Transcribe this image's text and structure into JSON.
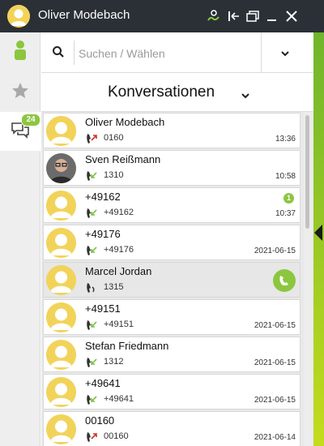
{
  "window": {
    "title": "Oliver Modebach"
  },
  "icons": {
    "title_avatar": "user-avatar-icon",
    "call_forward": "call-forward-icon",
    "pin": "pin-icon",
    "window_restore": "window-restore-icon",
    "minimize": "minimize-icon",
    "close": "close-icon",
    "contacts": "contacts-icon",
    "favorites": "star-icon",
    "conversations": "chat-icon",
    "search": "search-icon",
    "dropdown": "chevron-down-icon"
  },
  "sidebar": {
    "conversations_badge": "24"
  },
  "search": {
    "placeholder": "Suchen / Wählen",
    "value": ""
  },
  "header": {
    "title": "Konversationen"
  },
  "colors": {
    "accent_green": "#8cc63f",
    "titlebar": "#2b3036",
    "missed_call": "#d0312d",
    "incoming_call": "#7cc242"
  },
  "conversations": [
    {
      "name": "Oliver Modebach",
      "number": "0160",
      "time": "13:36",
      "direction": "outgoing",
      "avatar": "default",
      "unread": "",
      "selected": false
    },
    {
      "name": "Sven Reißmann",
      "number": "1310",
      "time": "10:58",
      "direction": "incoming",
      "avatar": "photo",
      "unread": "",
      "selected": false
    },
    {
      "name": "+49162",
      "number": "+49162",
      "time": "10:37",
      "direction": "incoming",
      "avatar": "default",
      "unread": "1",
      "selected": false
    },
    {
      "name": "+49176",
      "number": "+49176",
      "time": "2021-06-15",
      "direction": "incoming",
      "avatar": "default",
      "unread": "",
      "selected": false
    },
    {
      "name": "Marcel Jordan",
      "number": "1315",
      "time": "",
      "direction": "active",
      "avatar": "default",
      "unread": "",
      "selected": true
    },
    {
      "name": "+49151",
      "number": "+49151",
      "time": "2021-06-15",
      "direction": "incoming",
      "avatar": "default",
      "unread": "",
      "selected": false
    },
    {
      "name": "Stefan Friedmann",
      "number": "1312",
      "time": "2021-06-15",
      "direction": "incoming",
      "avatar": "default",
      "unread": "",
      "selected": false
    },
    {
      "name": "+49641",
      "number": "+49641",
      "time": "2021-06-15",
      "direction": "incoming",
      "avatar": "default",
      "unread": "",
      "selected": false
    },
    {
      "name": "00160",
      "number": "00160",
      "time": "2021-06-14",
      "direction": "outgoing",
      "avatar": "default",
      "unread": "",
      "selected": false
    }
  ]
}
